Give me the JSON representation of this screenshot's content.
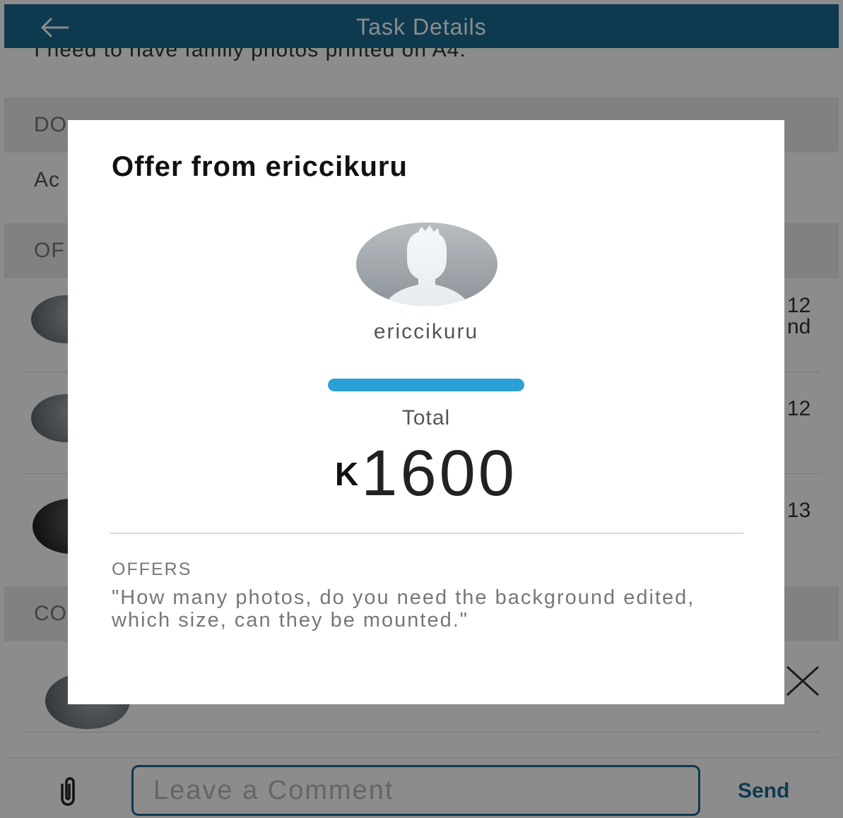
{
  "header": {
    "title": "Task Details",
    "back_icon": "arrow-left-icon"
  },
  "background": {
    "description_line": "I need to have family photos printed on A4.",
    "section1_label": "DO",
    "row2_label": "Ac",
    "section2_label": "OF",
    "offer_row1_right_top": "12",
    "offer_row1_right_bottom": "nd",
    "offer_row2_right": "12",
    "offer_row3_right": "13",
    "section3_label": "CO"
  },
  "comment_bar": {
    "placeholder": "Leave a Comment",
    "send_label": "Send",
    "attach_icon": "paperclip-icon"
  },
  "modal": {
    "title": "Offer from ericcikuru",
    "username": "ericcikuru",
    "total_label": "Total",
    "currency_symbol": "K",
    "amount": "1600",
    "offers_label": "OFFERS",
    "offer_message": "\"How many photos, do you need the background edited, which size, can they be mounted.\"",
    "progress": 1.0
  },
  "colors": {
    "primary": "#1a6b93",
    "progress": "#2a9fd8"
  }
}
